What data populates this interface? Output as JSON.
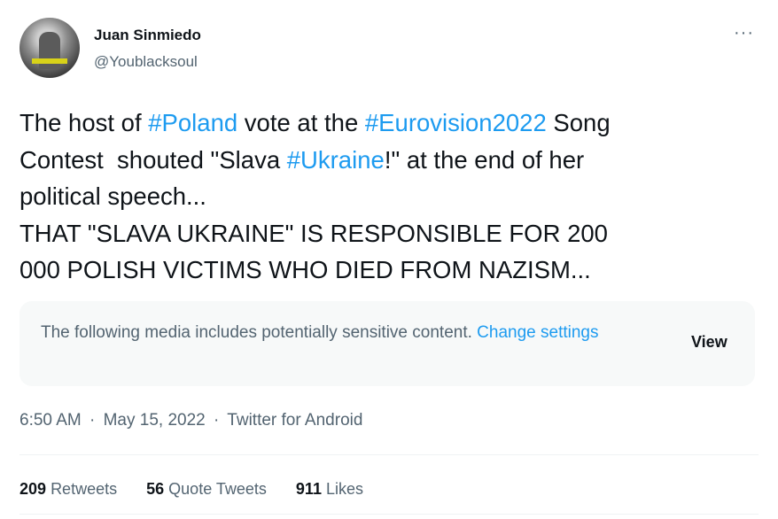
{
  "author": {
    "name": "Juan Sinmiedo",
    "handle": "@Youblacksoul",
    "more_icon": "more-horizontal-icon",
    "more_glyph": "···"
  },
  "tweet": {
    "line1": [
      {
        "text": "The host of ",
        "hashtag": false
      },
      {
        "text": "#Poland",
        "hashtag": true
      },
      {
        "text": " vote at the ",
        "hashtag": false
      },
      {
        "text": "#Eurovision2022",
        "hashtag": true
      },
      {
        "text": " Song",
        "hashtag": false
      }
    ],
    "line2": [
      {
        "text": "Contest  shouted \"Slava ",
        "hashtag": false
      },
      {
        "text": "#Ukraine",
        "hashtag": true
      },
      {
        "text": "!\" at the end of her",
        "hashtag": false
      }
    ],
    "line3": "political speech...",
    "line4": "THAT \"SLAVA UKRAINE\" IS RESPONSIBLE FOR 200",
    "line5": "000 POLISH VICTIMS WHO DIED FROM NAZISM..."
  },
  "sensitive_media": {
    "message": "The following media includes potentially sensitive content. ",
    "link_label": "Change settings",
    "view_label": "View"
  },
  "meta": {
    "time": "6:50 AM",
    "separator": "·",
    "date": "May 15, 2022",
    "source": "Twitter for Android"
  },
  "stats": {
    "retweets_count": "209",
    "retweets_label": "Retweets",
    "quotes_count": "56",
    "quotes_label": "Quote Tweets",
    "likes_count": "911",
    "likes_label": "Likes"
  },
  "colors": {
    "accent": "#1d9bf0",
    "text": "#0f1419",
    "secondary": "#536471",
    "box_bg": "#f7f9f9"
  }
}
